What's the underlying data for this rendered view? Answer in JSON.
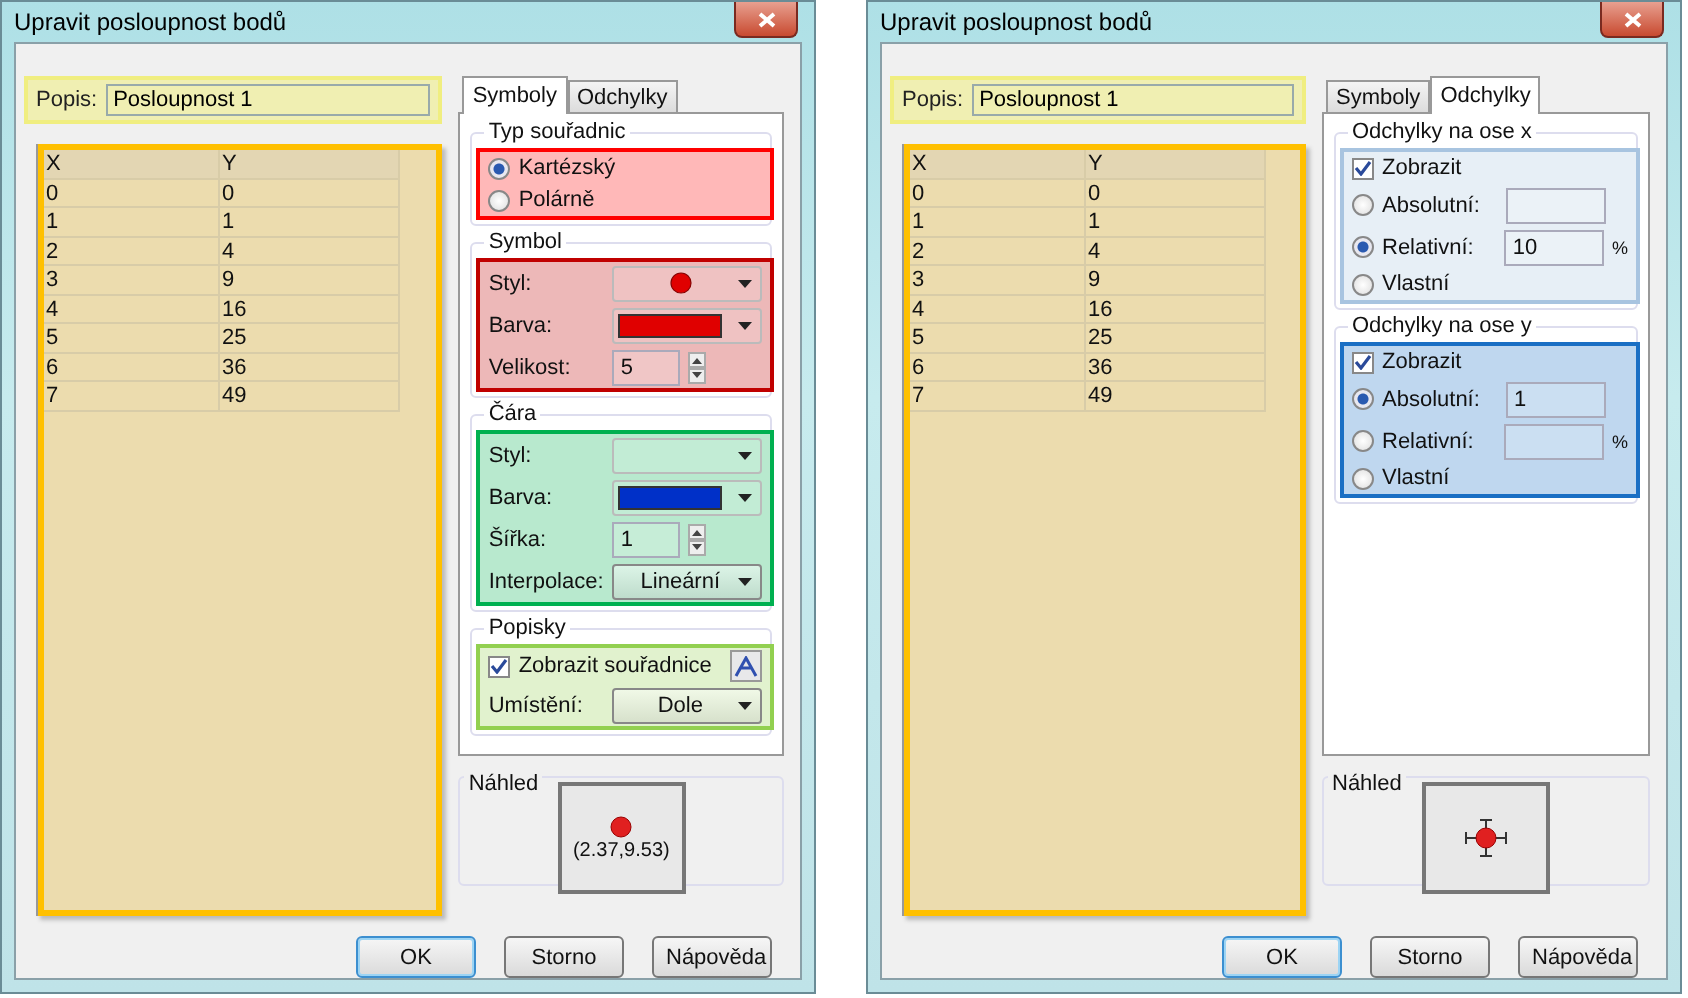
{
  "dialogs": [
    {
      "title": "Upravit posloupnost bodů",
      "description": {
        "label": "Popis:",
        "value": "Posloupnost 1",
        "color": "#f0ee80"
      },
      "table": {
        "color": "#ffc000",
        "columns": [
          "X",
          "Y"
        ],
        "rows": [
          [
            "0",
            "0"
          ],
          [
            "1",
            "1"
          ],
          [
            "2",
            "4"
          ],
          [
            "3",
            "9"
          ],
          [
            "4",
            "16"
          ],
          [
            "5",
            "25"
          ],
          [
            "6",
            "36"
          ],
          [
            "7",
            "49"
          ]
        ]
      },
      "tabs": [
        {
          "label": "Symboly",
          "selected": true
        },
        {
          "label": "Odchylky",
          "selected": false
        }
      ],
      "groups": [
        {
          "title": "Typ souřadnic",
          "color": "#ff0000",
          "rows": [
            {
              "kind": "radio",
              "label": "Kartézský",
              "selected": true
            },
            {
              "kind": "radio",
              "label": "Polárně",
              "selected": false
            }
          ]
        },
        {
          "title": "Symbol",
          "color": "#c00000",
          "rows": [
            {
              "kind": "symbol-combo",
              "label": "Styl:"
            },
            {
              "kind": "color",
              "label": "Barva:",
              "color": "#e00000"
            },
            {
              "kind": "spin",
              "label": "Velikost:",
              "value": "5"
            }
          ]
        },
        {
          "title": "Čára",
          "color": "#00b050",
          "rows": [
            {
              "kind": "combo",
              "label": "Styl:"
            },
            {
              "kind": "color",
              "label": "Barva:",
              "color": "#0030c8"
            },
            {
              "kind": "spin",
              "label": "Šířka:",
              "value": "1"
            },
            {
              "kind": "combo",
              "label": "Interpolace:",
              "value": "Lineární"
            }
          ]
        },
        {
          "title": "Popisky",
          "color": "#92d050",
          "rows": [
            {
              "kind": "checkbox",
              "label": "Zobrazit souřadnice",
              "checked": true,
              "tool_button": true
            },
            {
              "kind": "combo",
              "label": "Umístění:",
              "value": "Dole"
            }
          ]
        }
      ],
      "preview": {
        "label": "Náhled",
        "kind": "labeled-point",
        "caption": "(2.37,9.53)"
      },
      "buttons": [
        {
          "label": "OK",
          "default": true
        },
        {
          "label": "Storno",
          "default": false
        },
        {
          "label": "Nápověda",
          "default": false
        }
      ]
    },
    {
      "title": "Upravit posloupnost bodů",
      "description": {
        "label": "Popis:",
        "value": "Posloupnost 1",
        "color": "#f0ee80"
      },
      "table": {
        "color": "#ffc000",
        "columns": [
          "X",
          "Y"
        ],
        "rows": [
          [
            "0",
            "0"
          ],
          [
            "1",
            "1"
          ],
          [
            "2",
            "4"
          ],
          [
            "3",
            "9"
          ],
          [
            "4",
            "16"
          ],
          [
            "5",
            "25"
          ],
          [
            "6",
            "36"
          ],
          [
            "7",
            "49"
          ]
        ]
      },
      "tabs": [
        {
          "label": "Symboly",
          "selected": false
        },
        {
          "label": "Odchylky",
          "selected": true
        }
      ],
      "groups": [
        {
          "title": "Odchylky na ose x",
          "color": "#a8c4e0",
          "rows": [
            {
              "kind": "checkbox",
              "label": "Zobrazit",
              "checked": true
            },
            {
              "kind": "radio-field",
              "label": "Absolutní:",
              "selected": false
            },
            {
              "kind": "radio-field",
              "label": "Relativní:",
              "selected": true,
              "value": "10",
              "unit": "%"
            },
            {
              "kind": "radio",
              "label": "Vlastní",
              "selected": false
            }
          ]
        },
        {
          "title": "Odchylky na ose y",
          "color": "#1a6fc4",
          "rows": [
            {
              "kind": "checkbox",
              "label": "Zobrazit",
              "checked": true
            },
            {
              "kind": "radio-field",
              "label": "Absolutní:",
              "selected": true,
              "value": "1"
            },
            {
              "kind": "radio-field",
              "label": "Relativní:",
              "selected": false,
              "unit": "%"
            },
            {
              "kind": "radio",
              "label": "Vlastní",
              "selected": false
            }
          ]
        }
      ],
      "preview": {
        "label": "Náhled",
        "kind": "error-bars"
      },
      "buttons": [
        {
          "label": "OK",
          "default": true
        },
        {
          "label": "Storno",
          "default": false
        },
        {
          "label": "Nápověda",
          "default": false
        }
      ]
    }
  ]
}
